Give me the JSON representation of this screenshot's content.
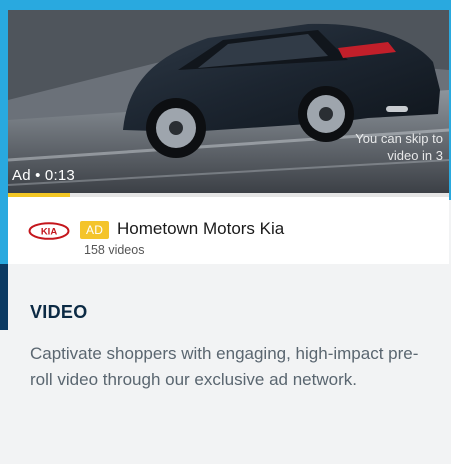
{
  "player": {
    "ad_time_label": "Ad • 0:13",
    "skip_text": "You can skip to video in 3",
    "ad_progress_fraction": 0.14
  },
  "channel": {
    "logo_text": "KIA",
    "ad_badge": "AD",
    "name": "Hometown Motors Kia",
    "video_count": "158 videos"
  },
  "card": {
    "title": "VIDEO",
    "description": "Captivate shoppers with engaging, high-impact pre-roll video through our exclusive ad network."
  },
  "colors": {
    "accent_blue": "#29a9df",
    "dark_navy": "#0c3a63",
    "ad_yellow": "#f4c42b",
    "kia_red": "#c4161c"
  }
}
